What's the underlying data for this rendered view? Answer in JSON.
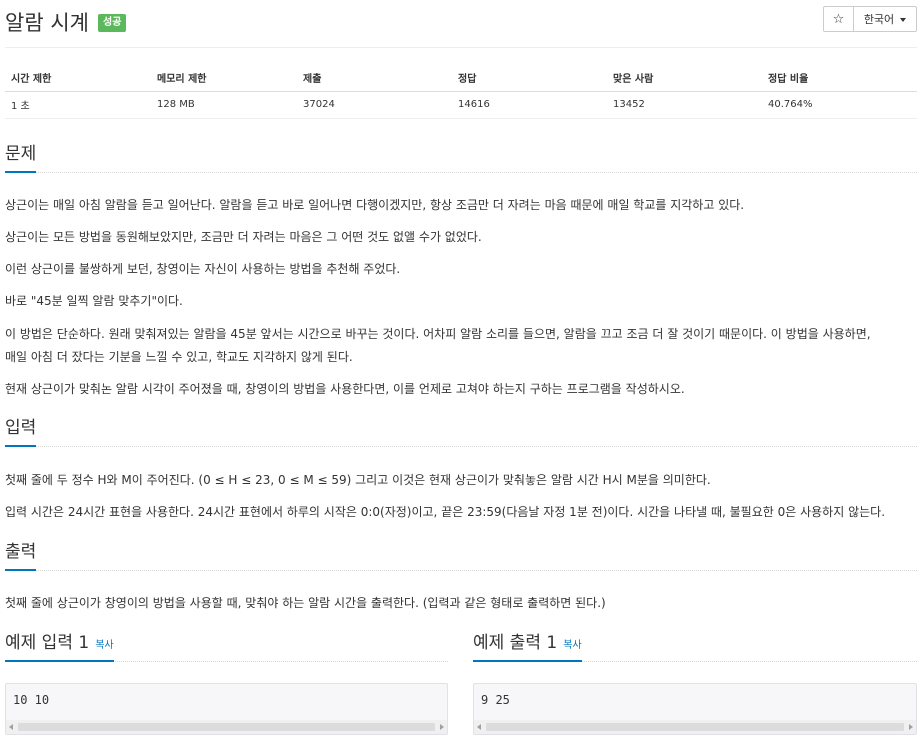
{
  "problem": {
    "title": "알람 시계",
    "status_badge": "성공",
    "star_glyph": "☆",
    "language": "한국어"
  },
  "info_table": {
    "headers": [
      "시간 제한",
      "메모리 제한",
      "제출",
      "정답",
      "맞은 사람",
      "정답 비율"
    ],
    "values": [
      "1 초",
      "128 MB",
      "37024",
      "14616",
      "13452",
      "40.764%"
    ]
  },
  "sections": {
    "problem_heading": "문제",
    "problem_paragraphs": [
      "상근이는 매일 아침 알람을 듣고 일어난다. 알람을 듣고 바로 일어나면 다행이겠지만, 항상 조금만 더 자려는 마음 때문에 매일 학교를 지각하고 있다.",
      "상근이는 모든 방법을 동원해보았지만, 조금만 더 자려는 마음은 그 어떤 것도 없앨 수가 없었다.",
      "이런 상근이를 불쌍하게 보던, 창영이는 자신이 사용하는 방법을 추천해 주었다.",
      "바로 \"45분 일찍 알람 맞추기\"이다.",
      "이 방법은 단순하다. 원래 맞춰져있는 알람을 45분 앞서는 시간으로 바꾸는 것이다. 어차피 알람 소리를 들으면, 알람을 끄고 조금 더 잘 것이기 때문이다. 이 방법을 사용하면,",
      "매일 아침 더 잤다는 기분을 느낄 수 있고, 학교도 지각하지 않게 된다.",
      "현재 상근이가 맞춰논 알람 시각이 주어졌을 때, 창영이의 방법을 사용한다면, 이를 언제로 고쳐야 하는지 구하는 프로그램을 작성하시오."
    ],
    "input_heading": "입력",
    "input_paragraphs": [
      "첫째 줄에 두 정수 H와 M이 주어진다. (0 ≤ H ≤ 23, 0 ≤ M ≤ 59) 그리고 이것은 현재 상근이가 맞춰놓은 알람 시간 H시 M분을 의미한다.",
      "입력 시간은 24시간 표현을 사용한다. 24시간 표현에서 하루의 시작은 0:0(자정)이고, 끝은 23:59(다음날 자정 1분 전)이다. 시간을 나타낼 때, 불필요한 0은 사용하지 않는다."
    ],
    "output_heading": "출력",
    "output_paragraphs": [
      "첫째 줄에 상근이가 창영이의 방법을 사용할 때, 맞춰야 하는 알람 시간을 출력한다. (입력과 같은 형태로 출력하면 된다.)"
    ]
  },
  "samples": {
    "input_title": "예제 입력 1",
    "output_title": "예제 출력 1",
    "copy_label": "복사",
    "input_value": "10 10",
    "output_value": "9 25"
  },
  "colors": {
    "accent": "#0076c0",
    "badge_success": "#5cb85c",
    "sample_bg": "#f7f7f9"
  }
}
